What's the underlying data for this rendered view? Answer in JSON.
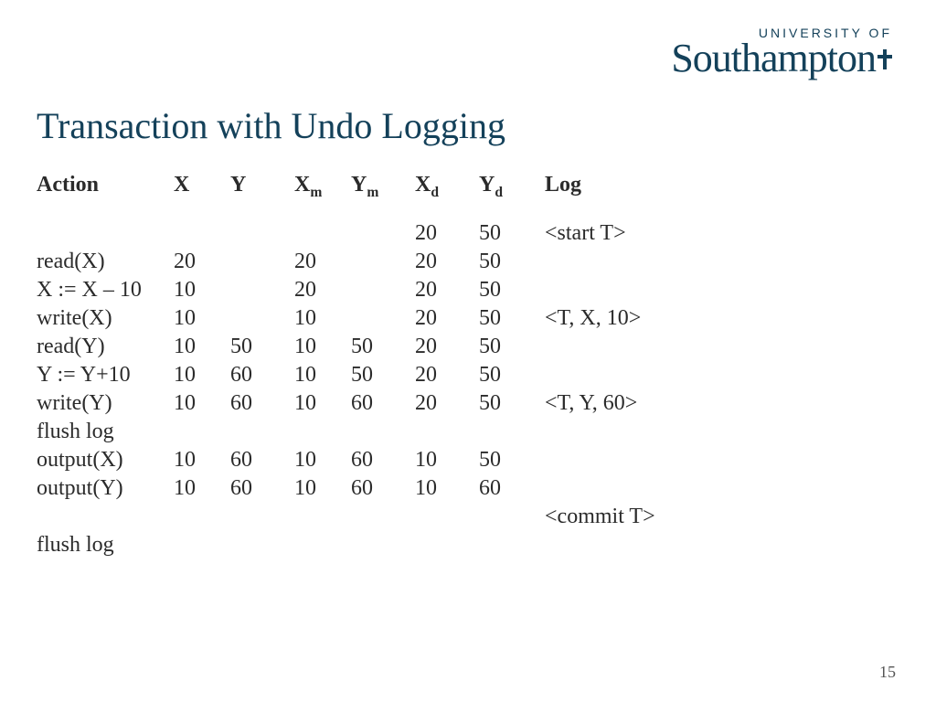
{
  "logo": {
    "uni_label": "UNIVERSITY OF",
    "name": "Southampton"
  },
  "title": "Transaction with Undo Logging",
  "headers": {
    "action": "Action",
    "x": "X",
    "y": "Y",
    "xm": "X",
    "xm_sub": "m",
    "ym": "Y",
    "ym_sub": "m",
    "xd": "X",
    "xd_sub": "d",
    "yd": "Y",
    "yd_sub": "d",
    "log": "Log"
  },
  "rows": [
    {
      "action": "",
      "x": "",
      "y": "",
      "xm": "",
      "ym": "",
      "xd": "20",
      "yd": "50",
      "log": "<start T>"
    },
    {
      "action": "read(X)",
      "x": "20",
      "y": "",
      "xm": "20",
      "ym": "",
      "xd": "20",
      "yd": "50",
      "log": ""
    },
    {
      "action": "X := X – 10",
      "x": "10",
      "y": "",
      "xm": "20",
      "ym": "",
      "xd": "20",
      "yd": "50",
      "log": ""
    },
    {
      "action": "write(X)",
      "x": "10",
      "y": "",
      "xm": "10",
      "ym": "",
      "xd": "20",
      "yd": "50",
      "log": "<T, X, 10>"
    },
    {
      "action": "read(Y)",
      "x": "10",
      "y": "50",
      "xm": "10",
      "ym": "50",
      "xd": "20",
      "yd": "50",
      "log": ""
    },
    {
      "action": "Y := Y+10",
      "x": "10",
      "y": "60",
      "xm": "10",
      "ym": "50",
      "xd": "20",
      "yd": "50",
      "log": ""
    },
    {
      "action": "write(Y)",
      "x": "10",
      "y": "60",
      "xm": "10",
      "ym": "60",
      "xd": "20",
      "yd": "50",
      "log": "<T, Y, 60>"
    },
    {
      "action": "flush log",
      "x": "",
      "y": "",
      "xm": "",
      "ym": "",
      "xd": "",
      "yd": "",
      "log": ""
    },
    {
      "action": "output(X)",
      "x": "10",
      "y": "60",
      "xm": "10",
      "ym": "60",
      "xd": "10",
      "yd": "50",
      "log": ""
    },
    {
      "action": "output(Y)",
      "x": "10",
      "y": "60",
      "xm": "10",
      "ym": "60",
      "xd": "10",
      "yd": "60",
      "log": ""
    },
    {
      "action": "",
      "x": "",
      "y": "",
      "xm": "",
      "ym": "",
      "xd": "",
      "yd": "",
      "log": "<commit T>"
    },
    {
      "action": "flush log",
      "x": "",
      "y": "",
      "xm": "",
      "ym": "",
      "xd": "",
      "yd": "",
      "log": ""
    }
  ],
  "page_number": "15",
  "chart_data": {
    "type": "table",
    "columns": [
      "Action",
      "X",
      "Y",
      "Xm",
      "Ym",
      "Xd",
      "Yd",
      "Log"
    ],
    "data": [
      [
        "",
        "",
        "",
        "",
        "",
        "20",
        "50",
        "<start T>"
      ],
      [
        "read(X)",
        "20",
        "",
        "20",
        "",
        "20",
        "50",
        ""
      ],
      [
        "X := X – 10",
        "10",
        "",
        "20",
        "",
        "20",
        "50",
        ""
      ],
      [
        "write(X)",
        "10",
        "",
        "10",
        "",
        "20",
        "50",
        "<T, X, 10>"
      ],
      [
        "read(Y)",
        "10",
        "50",
        "10",
        "50",
        "20",
        "50",
        ""
      ],
      [
        "Y := Y+10",
        "10",
        "60",
        "10",
        "50",
        "20",
        "50",
        ""
      ],
      [
        "write(Y)",
        "10",
        "60",
        "10",
        "60",
        "20",
        "50",
        "<T, Y, 60>"
      ],
      [
        "flush log",
        "",
        "",
        "",
        "",
        "",
        "",
        ""
      ],
      [
        "output(X)",
        "10",
        "60",
        "10",
        "60",
        "10",
        "50",
        ""
      ],
      [
        "output(Y)",
        "10",
        "60",
        "10",
        "60",
        "10",
        "60",
        ""
      ],
      [
        "",
        "",
        "",
        "",
        "",
        "",
        "",
        "<commit T>"
      ],
      [
        "flush log",
        "",
        "",
        "",
        "",
        "",
        "",
        ""
      ]
    ]
  }
}
